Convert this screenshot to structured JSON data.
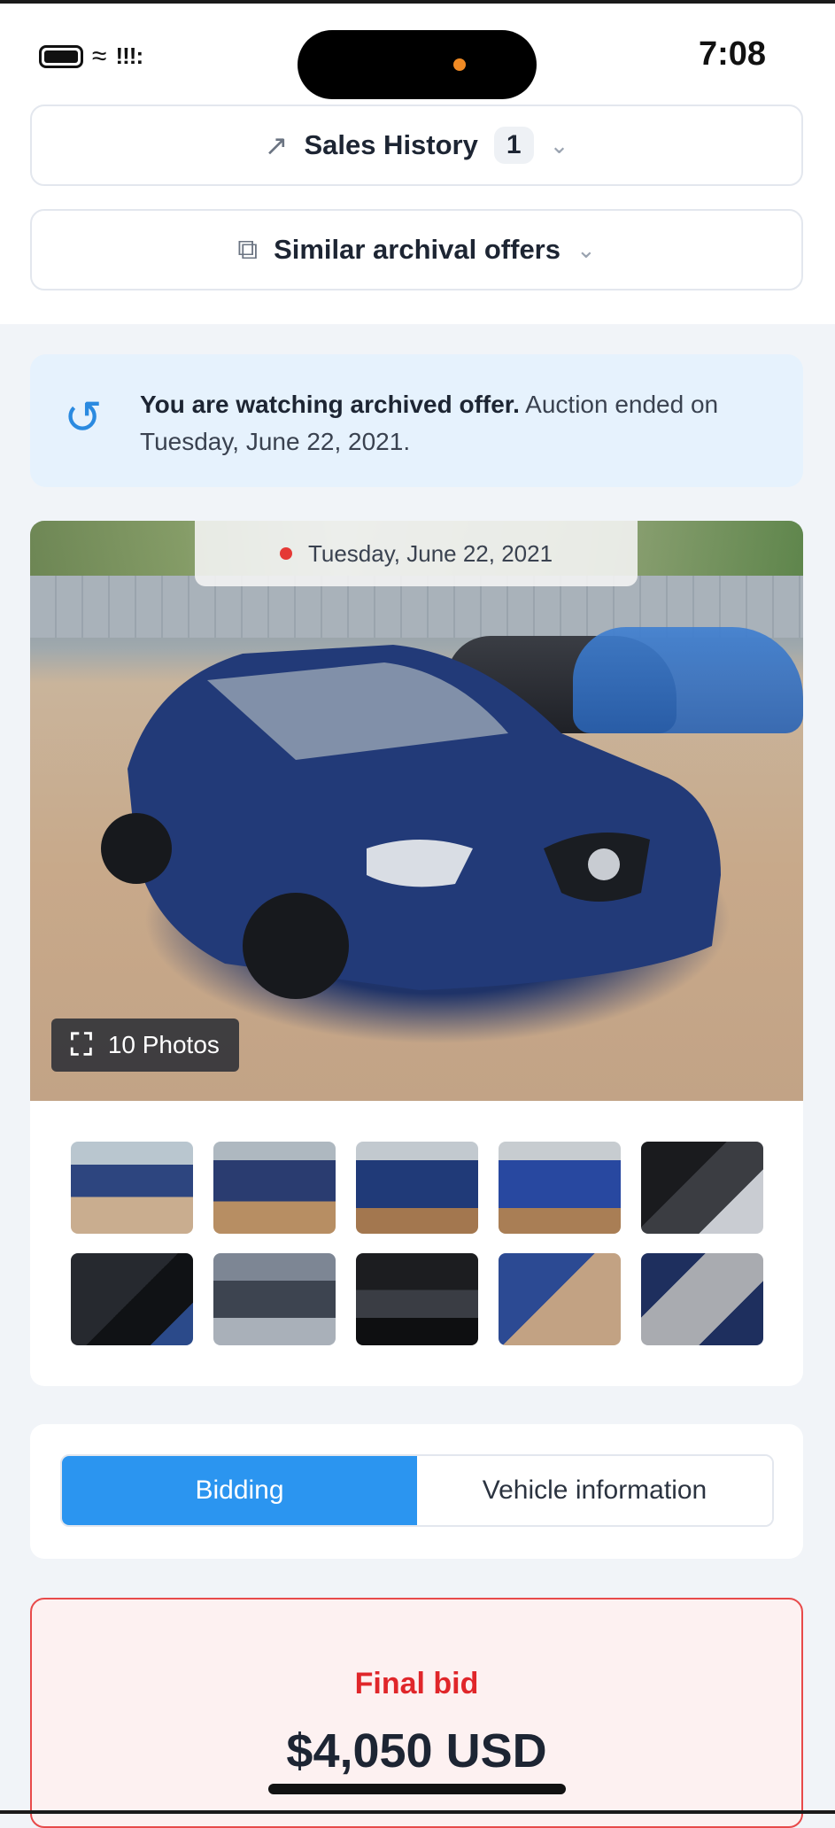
{
  "status_bar": {
    "time": "7:08"
  },
  "accordions": {
    "sales_history": {
      "label": "Sales History",
      "count": "1"
    },
    "similar_offers": {
      "label": "Similar archival offers"
    }
  },
  "notice": {
    "bold": "You are watching archived offer.",
    "text": " Auction ended on Tuesday, June 22, 2021."
  },
  "gallery": {
    "date": "Tuesday, June 22, 2021",
    "photos_label": "10 Photos",
    "thumbnail_count": 10
  },
  "tabs": [
    {
      "label": "Bidding",
      "active": true
    },
    {
      "label": "Vehicle information",
      "active": false
    }
  ],
  "bid": {
    "label": "Final bid",
    "value": "$4,050 USD"
  },
  "colors": {
    "accent": "#2b95f0",
    "danger": "#e0262a",
    "notice_bg": "#e6f2fd"
  }
}
